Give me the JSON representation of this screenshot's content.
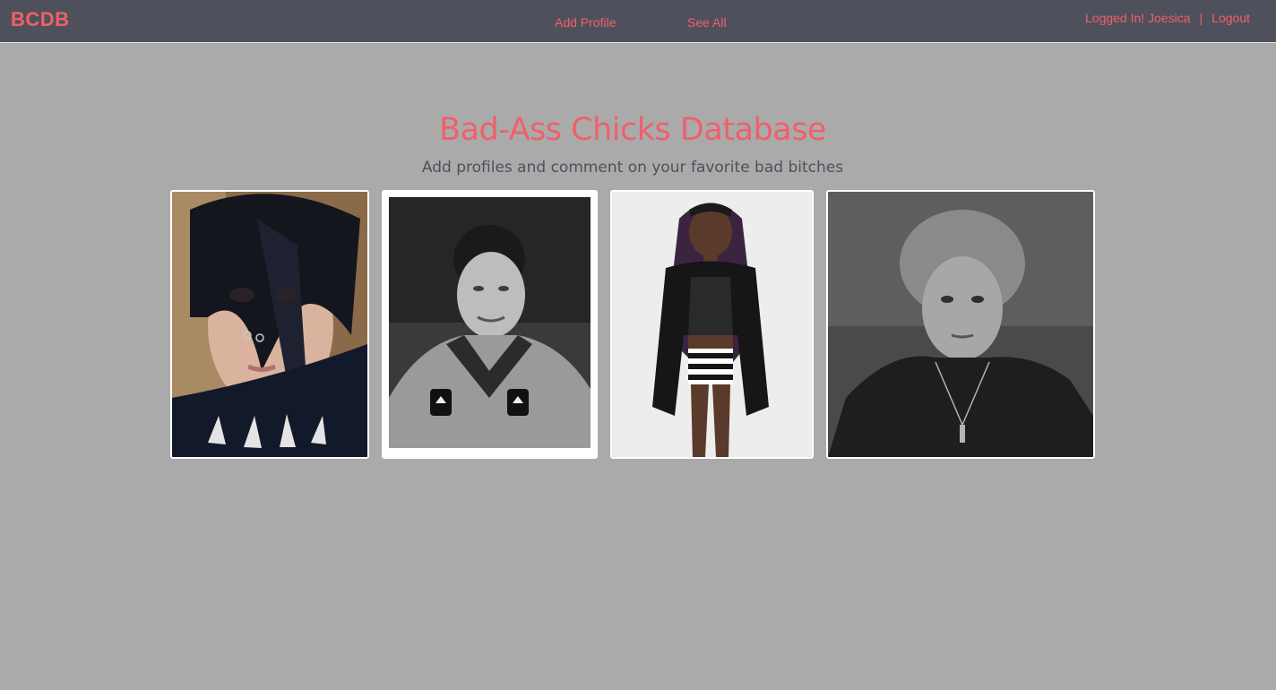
{
  "navbar": {
    "brand": "BCDB",
    "links": [
      {
        "label": "Add Profile"
      },
      {
        "label": "See All"
      }
    ],
    "user_status": "Logged In! Joesica",
    "separator": "|",
    "logout_label": "Logout"
  },
  "hero": {
    "title": "Bad-Ass Chicks Database",
    "subtitle": "Add profiles and comment on your favorite bad bitches"
  },
  "colors": {
    "accent": "#f0606a",
    "navbar_bg": "#4e515b",
    "page_bg": "#aaaaaa",
    "subtitle": "#4e515b"
  },
  "profiles": [
    {
      "photo": "punk-woman-portrait-photo"
    },
    {
      "photo": "graduation-gown-portrait-photo"
    },
    {
      "photo": "fashion-model-full-body-photo"
    },
    {
      "photo": "historical-woman-portrait-photo"
    }
  ]
}
